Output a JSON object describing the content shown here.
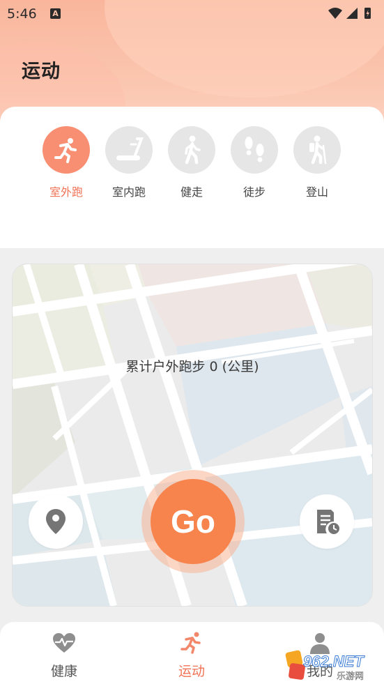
{
  "status_bar": {
    "time": "5:46",
    "notification_letter": "A"
  },
  "page_title": "运动",
  "sport_types": [
    {
      "label": "室外跑",
      "icon": "running-icon",
      "active": true
    },
    {
      "label": "室内跑",
      "icon": "treadmill-icon",
      "active": false
    },
    {
      "label": "健走",
      "icon": "walking-icon",
      "active": false
    },
    {
      "label": "徒步",
      "icon": "footprints-icon",
      "active": false
    },
    {
      "label": "登山",
      "icon": "hiking-icon",
      "active": false
    }
  ],
  "map": {
    "stat_text": "累计户外跑步 0 (公里)"
  },
  "go_button": {
    "label": "Go"
  },
  "bottom_nav": [
    {
      "label": "健康",
      "icon": "heart-pulse-icon",
      "active": false
    },
    {
      "label": "运动",
      "icon": "running-icon",
      "active": true
    },
    {
      "label": "我的",
      "icon": "user-icon",
      "active": false
    }
  ],
  "watermark": {
    "text": "962.NET",
    "subtext": "乐游网"
  },
  "colors": {
    "accent": "#f98f72",
    "go": "#f8844d",
    "active_text": "#f07355",
    "inactive_circle": "#e6e6e6"
  }
}
